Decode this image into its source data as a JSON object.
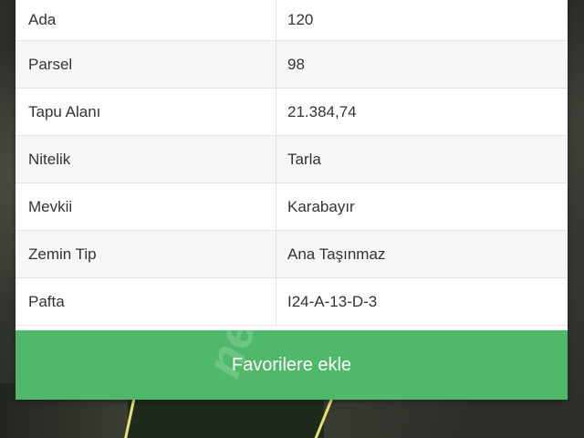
{
  "details": {
    "rows": [
      {
        "label": "Ada",
        "value": "120"
      },
      {
        "label": "Parsel",
        "value": "98"
      },
      {
        "label": "Tapu Alanı",
        "value": "21.384,74"
      },
      {
        "label": "Nitelik",
        "value": "Tarla"
      },
      {
        "label": "Mevkii",
        "value": "Karabayır"
      },
      {
        "label": "Zemin Tip",
        "value": "Ana Taşınmaz"
      },
      {
        "label": "Pafta",
        "value": "I24-A-13-D-3"
      }
    ]
  },
  "actions": {
    "favorite_label": "Favorilere ekle"
  },
  "colors": {
    "accent": "#4fb86a"
  }
}
